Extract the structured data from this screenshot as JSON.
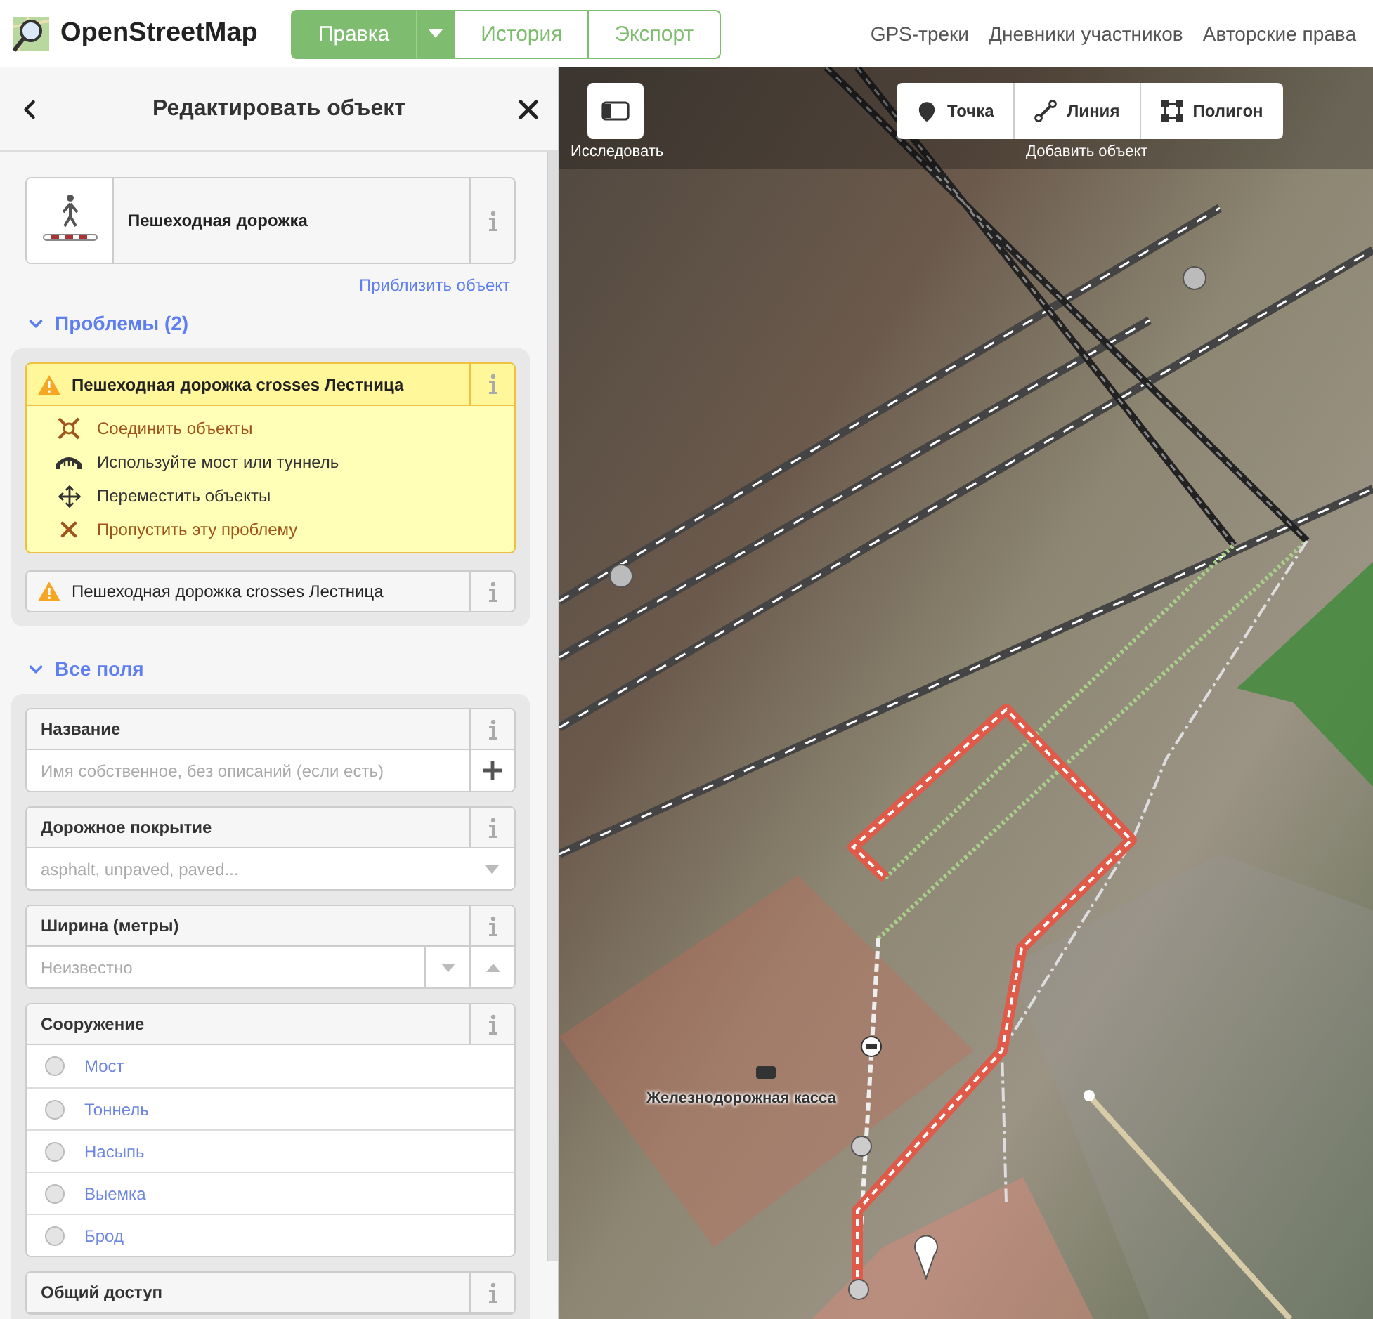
{
  "header": {
    "logo": "OpenStreetMap",
    "tabs": [
      {
        "label": "Правка",
        "selected": true
      },
      {
        "label": "История",
        "selected": false
      },
      {
        "label": "Экспорт",
        "selected": false
      }
    ],
    "links": [
      "GPS-треки",
      "Дневники участников",
      "Авторские права"
    ]
  },
  "sidebar": {
    "title": "Редактировать объект",
    "preset": {
      "name": "Пешеходная дорожка"
    },
    "zoom_link": "Приблизить объект",
    "issues": {
      "heading": "Проблемы (2)",
      "expanded": true,
      "items": [
        {
          "message": "Пешеходная дорожка crosses Лестница",
          "expanded": true,
          "fixes": [
            {
              "kind": "connect",
              "label": "Соединить объекты",
              "actionable": true
            },
            {
              "kind": "bridge",
              "label": "Используйте мост или туннель",
              "actionable": false
            },
            {
              "kind": "move",
              "label": "Переместить объекты",
              "actionable": false
            },
            {
              "kind": "ignore",
              "label": "Пропустить эту проблему",
              "actionable": true
            }
          ]
        },
        {
          "message": "Пешеходная дорожка crosses Лестница",
          "expanded": false
        }
      ]
    },
    "fields": {
      "heading": "Все поля",
      "expanded": true,
      "items": [
        {
          "kind": "text",
          "label": "Название",
          "placeholder": "Имя собственное, без описаний (если есть)"
        },
        {
          "kind": "combo",
          "label": "Дорожное покрытие",
          "placeholder": "asphalt, unpaved, paved..."
        },
        {
          "kind": "number",
          "label": "Ширина (метры)",
          "placeholder": "Неизвестно"
        },
        {
          "kind": "radio",
          "label": "Сооружение",
          "options": [
            {
              "label": "Мост",
              "selected": false
            },
            {
              "label": "Тоннель",
              "selected": false
            },
            {
              "label": "Насыпь",
              "selected": false
            },
            {
              "label": "Выемка",
              "selected": false
            },
            {
              "label": "Брод",
              "selected": false
            }
          ]
        },
        {
          "kind": "header",
          "label": "Общий доступ"
        }
      ]
    }
  },
  "map": {
    "explore": "Исследовать",
    "add_label": "Добавить объект",
    "add_buttons": [
      {
        "kind": "point",
        "label": "Точка"
      },
      {
        "kind": "line",
        "label": "Линия"
      },
      {
        "kind": "area",
        "label": "Полигон"
      }
    ],
    "labels": [
      "Железнодорожная касса"
    ]
  }
}
